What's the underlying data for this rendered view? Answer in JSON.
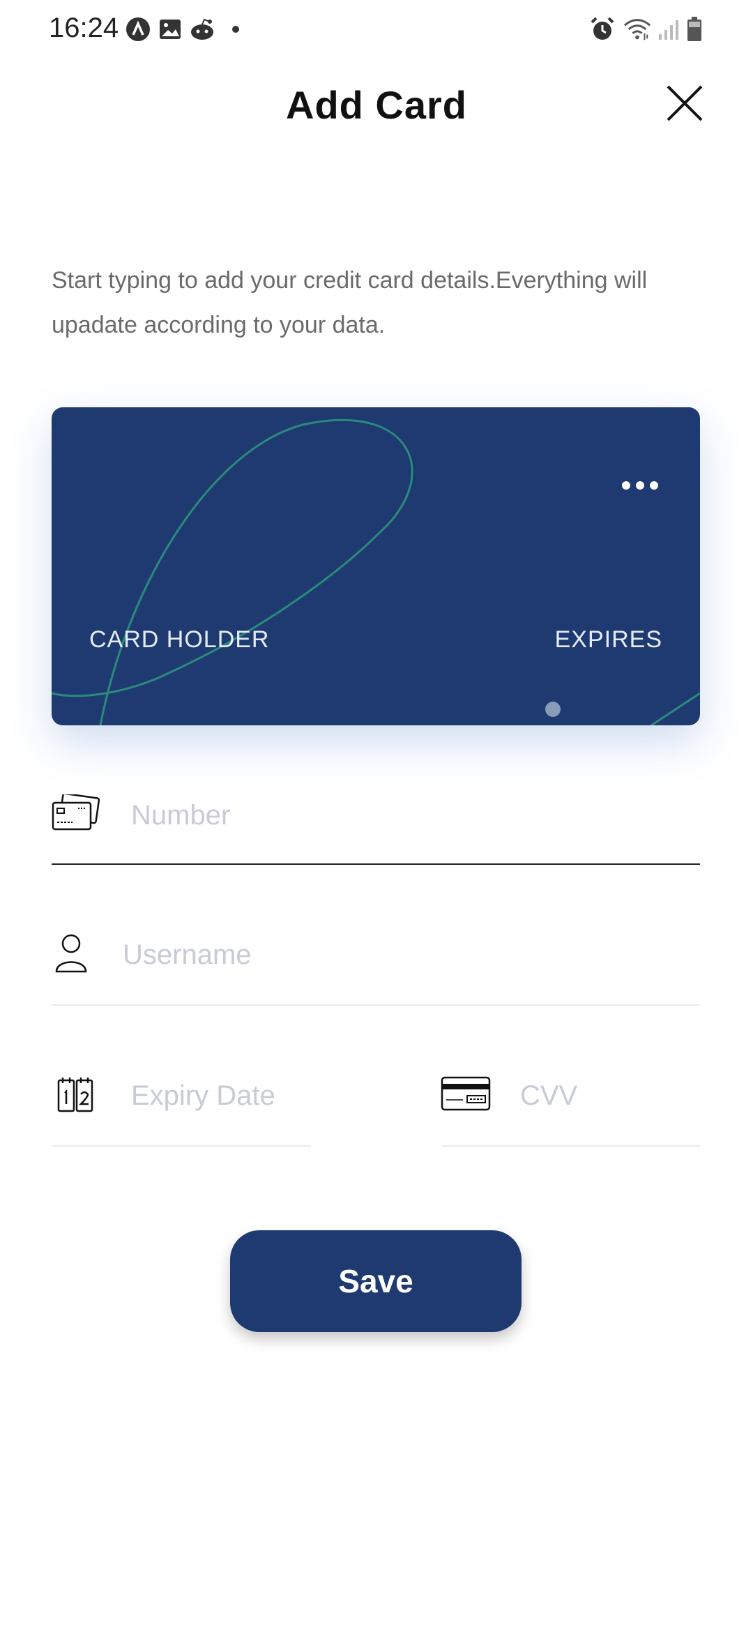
{
  "status_bar": {
    "time": "16:24",
    "left_icons": [
      "a-app-icon",
      "gallery-icon",
      "reddit-icon",
      "dot-icon"
    ],
    "right_icons": [
      "alarm-icon",
      "wifi-icon",
      "signal-icon",
      "battery-icon"
    ]
  },
  "header": {
    "title": "Add Card",
    "close_icon": "close-icon"
  },
  "intro_text": "Start typing to add your credit card details.Everything will upadate according to your data.",
  "card": {
    "holder_label": "CARD HOLDER",
    "expires_label": "EXPIRES",
    "menu_icon": "more-dots-icon",
    "color": "#1f3a70",
    "accent_line_color": "#2a8a7c"
  },
  "form": {
    "number": {
      "placeholder": "Number",
      "value": "",
      "icon": "credit-cards-icon"
    },
    "username": {
      "placeholder": "Username",
      "value": "",
      "icon": "user-icon"
    },
    "expiry": {
      "placeholder": "Expiry Date",
      "value": "",
      "icon": "calendar-icon"
    },
    "cvv": {
      "placeholder": "CVV",
      "value": "",
      "icon": "card-cvv-icon"
    }
  },
  "save_button": {
    "label": "Save",
    "color": "#1f3a70"
  }
}
